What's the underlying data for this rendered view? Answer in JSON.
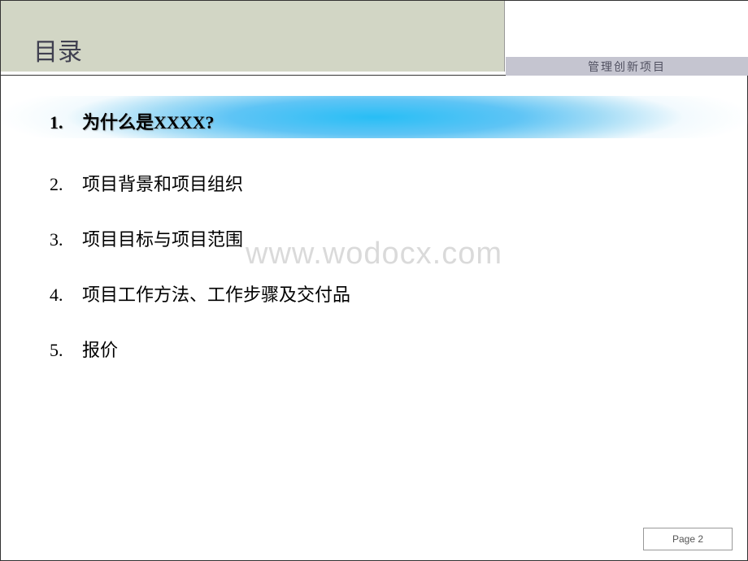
{
  "header": {
    "title": "目录",
    "subtitle": "管理创新项目"
  },
  "toc": [
    {
      "number": "1.",
      "text": "为什么是XXXX?",
      "highlighted": true
    },
    {
      "number": "2.",
      "text": "项目背景和项目组织",
      "highlighted": false
    },
    {
      "number": "3.",
      "text": "项目目标与项目范围",
      "highlighted": false
    },
    {
      "number": "4.",
      "text": "项目工作方法、工作步骤及交付品",
      "highlighted": false
    },
    {
      "number": "5.",
      "text": "报价",
      "highlighted": false
    }
  ],
  "watermark": "www.wodocx.com",
  "footer": {
    "page_label": "Page 2"
  }
}
